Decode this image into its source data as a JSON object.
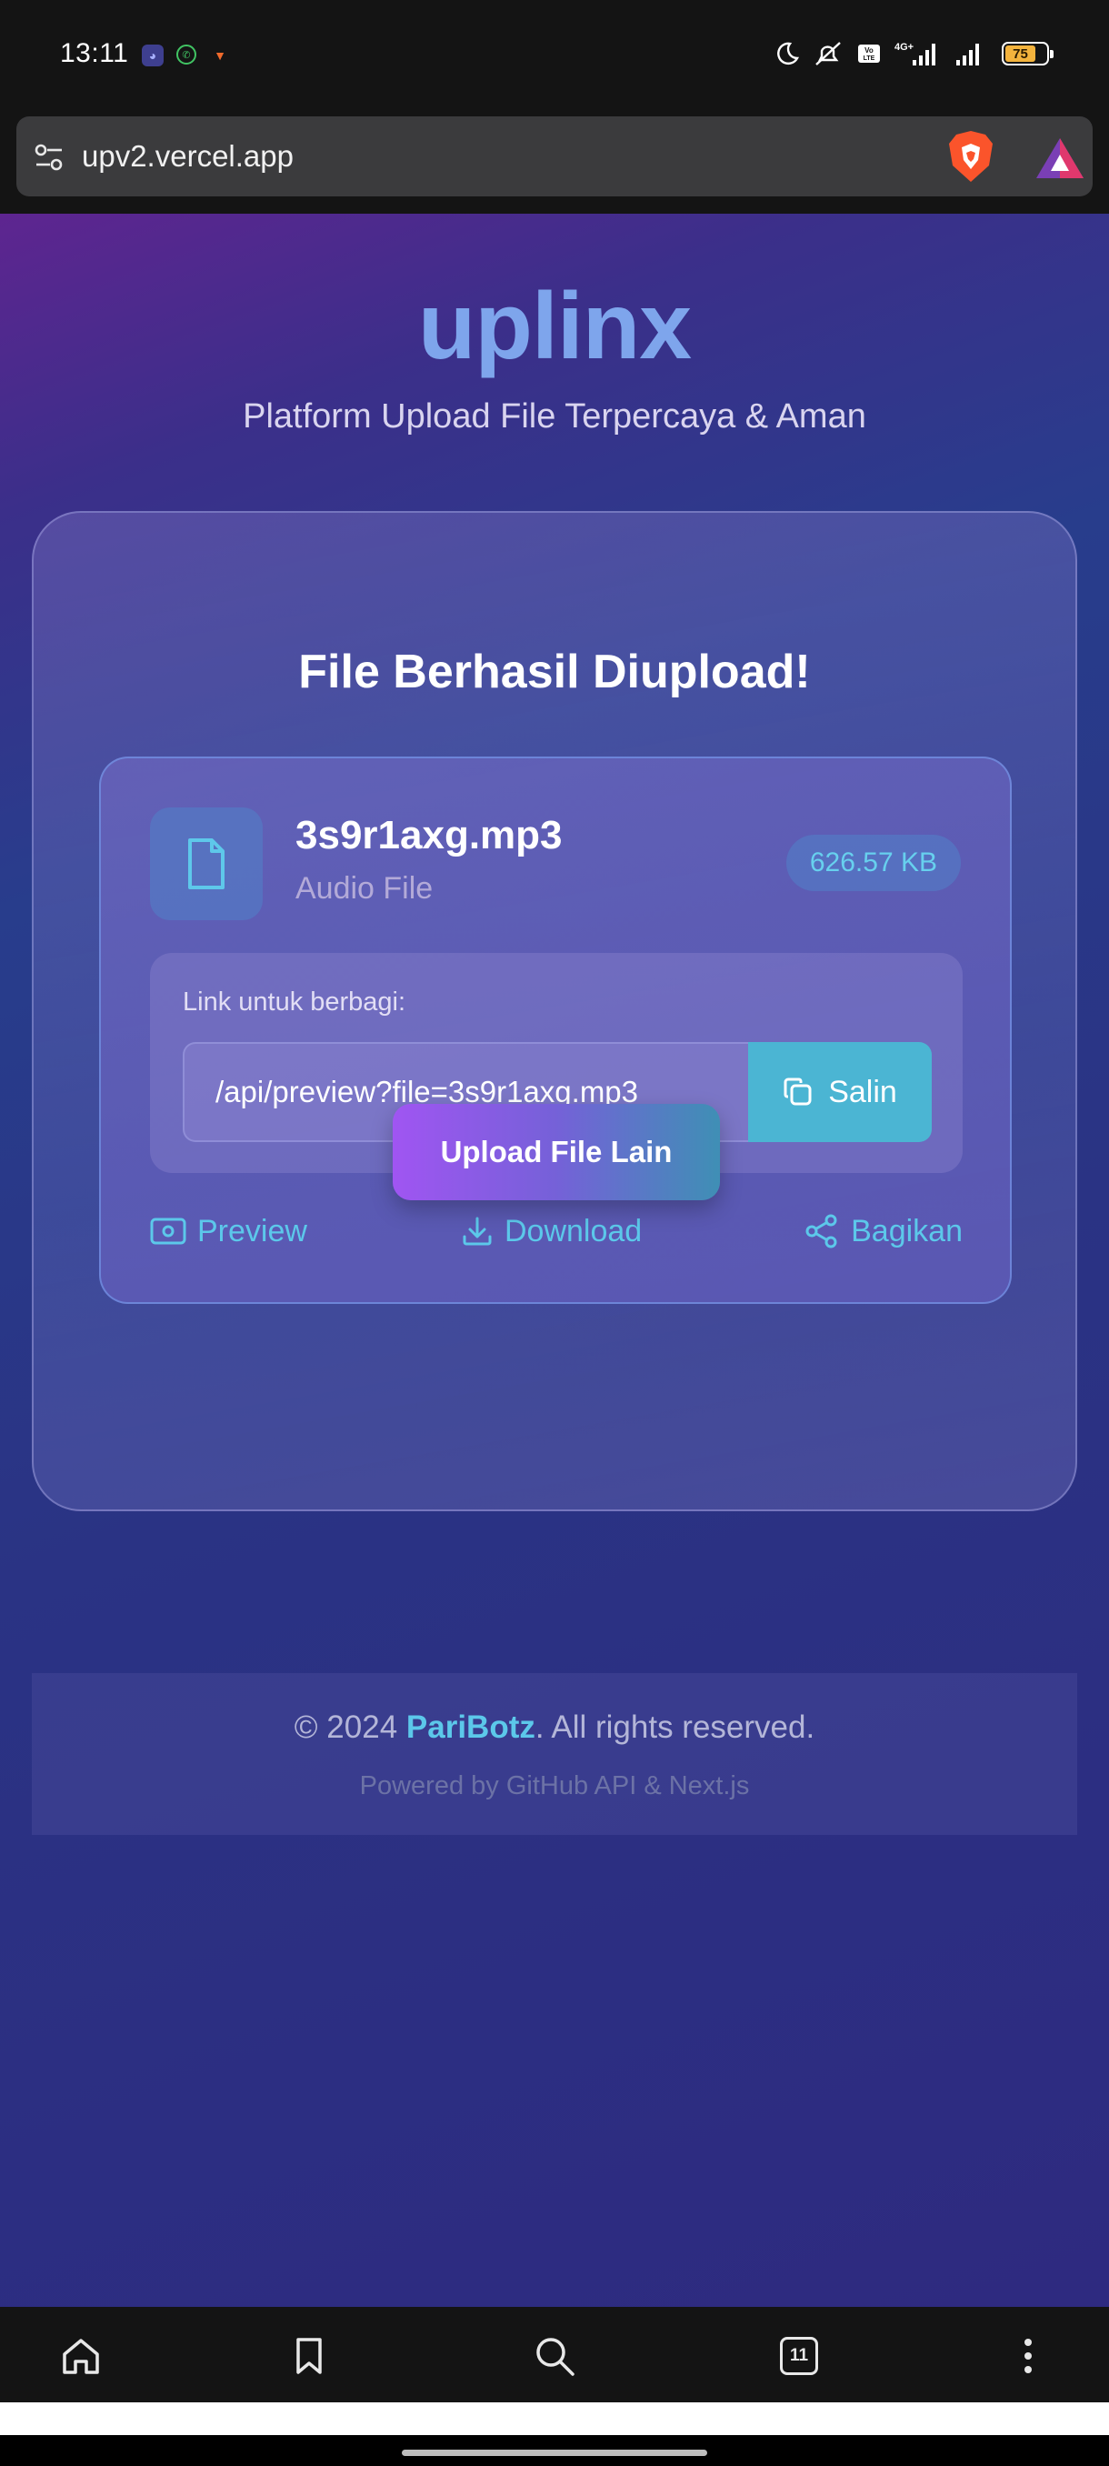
{
  "status_bar": {
    "time": "13:11",
    "notifications": [
      "discord-icon",
      "whatsapp-icon",
      "brave-notif-icon"
    ],
    "battery_level": "75"
  },
  "browser": {
    "url": "upv2.vercel.app"
  },
  "page": {
    "title": "uplinx",
    "subtitle": "Platform Upload File Terpercaya & Aman"
  },
  "result": {
    "heading": "File Berhasil Diupload!",
    "file": {
      "name": "3s9r1axg.mp3",
      "type": "Audio File",
      "size": "626.57 KB"
    },
    "share": {
      "label": "Link untuk berbagi:",
      "link": "/api/preview?file=3s9r1axg.mp3",
      "copy_label": "Salin"
    },
    "actions": {
      "preview": "Preview",
      "download": "Download",
      "share": "Bagikan"
    },
    "upload_another": "Upload File Lain"
  },
  "footer": {
    "copyright_prefix": "© 2024 ",
    "brand": "PariBotz",
    "copyright_suffix": ". All rights reserved.",
    "powered": "Powered by GitHub API & Next.js"
  },
  "bottom_nav": {
    "tab_count": "11"
  },
  "colors": {
    "accent_cyan": "#5cc8ea",
    "title_blue": "#7ea5ec",
    "copy_button": "#4bb5d3"
  }
}
